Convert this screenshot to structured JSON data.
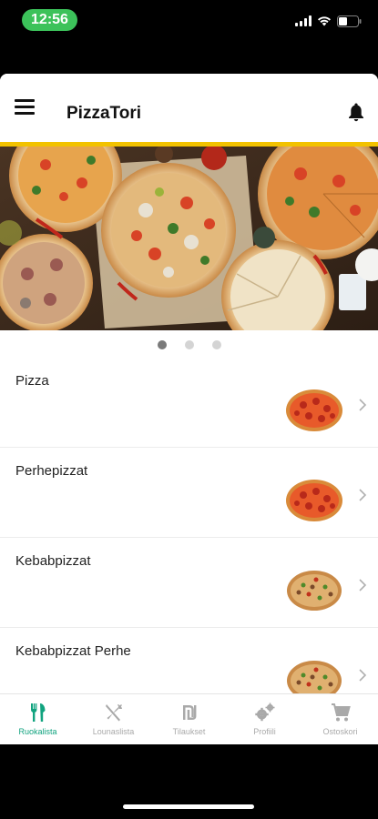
{
  "status_bar": {
    "time": "12:56"
  },
  "header": {
    "title": "PizzaTori",
    "menu_icon": "hamburger-menu-icon",
    "notification_icon": "bell-icon"
  },
  "colors": {
    "accent_yellow": "#f2c200",
    "active_green": "#11a37f",
    "time_pill_green": "#3cc25a",
    "inactive_gray": "#a9a9a9"
  },
  "banner": {
    "image": "pizzas-on-wooden-table-photo",
    "slide_count": 3,
    "active_slide": 1
  },
  "categories": [
    {
      "name": "Pizza",
      "thumb": "pepperoni-pizza"
    },
    {
      "name": "Perhepizzat",
      "thumb": "pepperoni-pizza"
    },
    {
      "name": "Kebabpizzat",
      "thumb": "kebab-pizza"
    },
    {
      "name": "Kebabpizzat Perhe",
      "thumb": "kebab-pizza"
    }
  ],
  "bottom_nav": [
    {
      "label": "Ruokalista",
      "icon": "fork-knife-icon",
      "active": true
    },
    {
      "label": "Lounaslista",
      "icon": "crossed-utensils-icon",
      "active": false
    },
    {
      "label": "Tilaukset",
      "icon": "orders-icon",
      "active": false
    },
    {
      "label": "Profiili",
      "icon": "gears-icon",
      "active": false
    },
    {
      "label": "Ostoskori",
      "icon": "cart-icon",
      "active": false
    }
  ]
}
